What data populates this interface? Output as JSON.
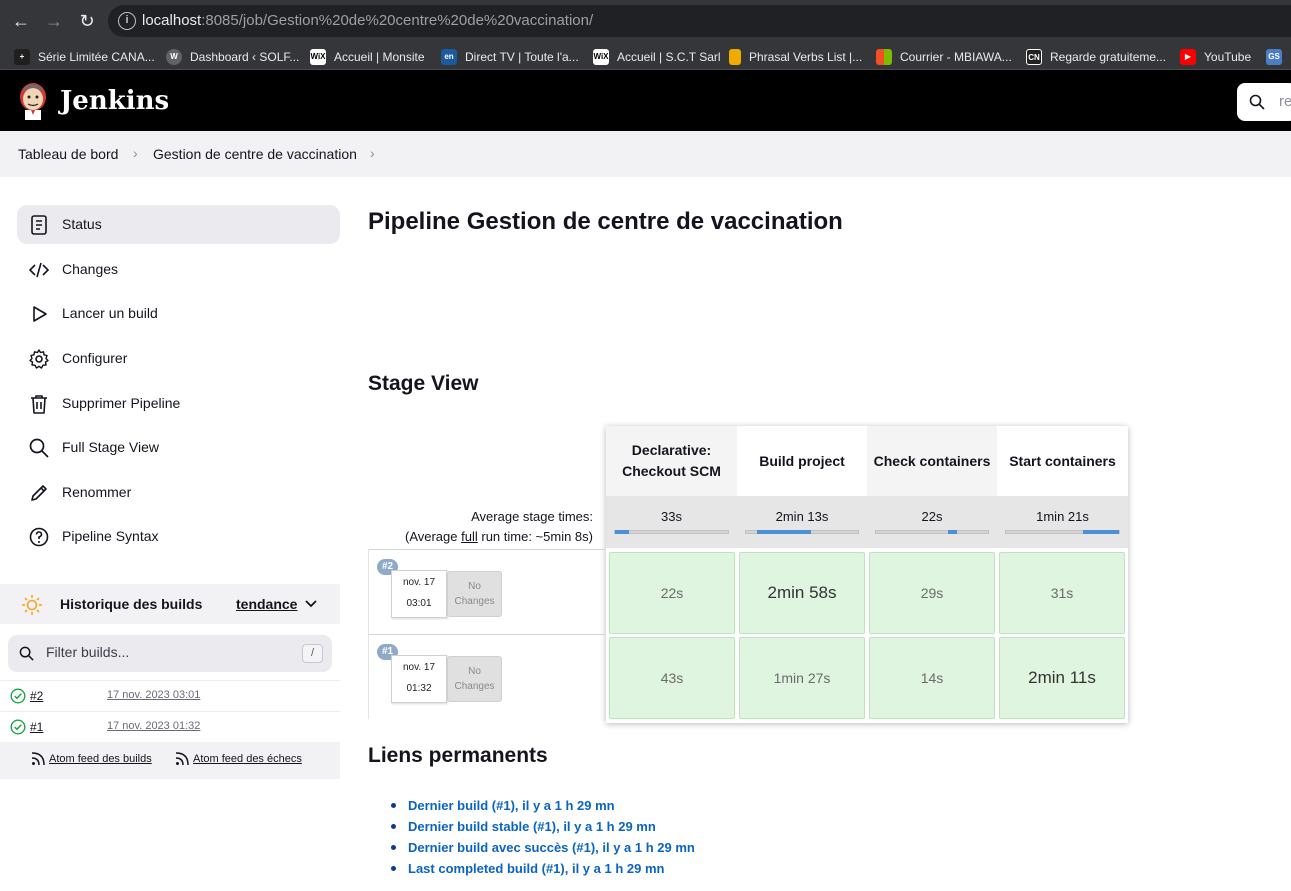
{
  "browser": {
    "url_host": "localhost",
    "url_path": ":8085/job/Gestion%20de%20centre%20de%20vaccination/",
    "bookmarks": [
      {
        "label": "Série Limitée CANA...",
        "icon": "plus-icon",
        "color": "#1f1f1f"
      },
      {
        "label": "Dashboard ‹ SOLF...",
        "icon": "wordpress-icon",
        "color": "#5f6368"
      },
      {
        "label": "Accueil | Monsite",
        "icon": "wix-icon",
        "color": "#ffffff"
      },
      {
        "label": "Direct TV | Toute l'a...",
        "icon": "en-icon",
        "color": "#1a5a9e"
      },
      {
        "label": "Accueil | S.C.T Sarl",
        "icon": "wix-icon",
        "color": "#ffffff"
      },
      {
        "label": "Phrasal Verbs List |...",
        "icon": "bookmark-icon",
        "color": "#f2a900"
      },
      {
        "label": "Courrier - MBIAWA...",
        "icon": "microsoft-icon",
        "color": "#f25022"
      },
      {
        "label": "Regarde gratuiteme...",
        "icon": "cn-icon",
        "color": "#222222"
      },
      {
        "label": "YouTube",
        "icon": "youtube-icon",
        "color": "#ff0000"
      }
    ]
  },
  "header": {
    "app_name": "Jenkins",
    "search_placeholder": "re"
  },
  "breadcrumb": {
    "items": [
      "Tableau de bord",
      "Gestion de centre de vaccination"
    ]
  },
  "sidebar": {
    "items": [
      {
        "label": "Status",
        "icon": "status-icon",
        "active": true
      },
      {
        "label": "Changes",
        "icon": "code-icon"
      },
      {
        "label": "Lancer un build",
        "icon": "play-icon"
      },
      {
        "label": "Configurer",
        "icon": "gear-icon"
      },
      {
        "label": "Supprimer Pipeline",
        "icon": "trash-icon"
      },
      {
        "label": "Full Stage View",
        "icon": "search-icon"
      },
      {
        "label": "Renommer",
        "icon": "pencil-icon"
      },
      {
        "label": "Pipeline Syntax",
        "icon": "help-icon"
      }
    ],
    "history": {
      "title": "Historique des builds",
      "trend": "tendance",
      "filter_placeholder": "Filter builds...",
      "shortcut": "/",
      "builds": [
        {
          "number": "#2",
          "date": "17 nov. 2023 03:01",
          "status": "success"
        },
        {
          "number": "#1",
          "date": "17 nov. 2023 01:32",
          "status": "success"
        }
      ],
      "feeds": [
        "Atom feed des builds",
        "Atom feed des échecs"
      ]
    }
  },
  "main": {
    "title": "Pipeline Gestion de centre de vaccination",
    "stage_view_title": "Stage View",
    "avg_label_1": "Average stage times:",
    "avg_label_2_prefix": "(Average ",
    "avg_label_2_link": "full",
    "avg_label_2_suffix": " run time: ~5min 8s)",
    "stages": [
      {
        "name": "Declarative: Checkout SCM",
        "avg": "33s"
      },
      {
        "name": "Build project",
        "avg": "2min 13s"
      },
      {
        "name": "Check containers",
        "avg": "22s"
      },
      {
        "name": "Start containers",
        "avg": "1min 21s"
      }
    ],
    "runs": [
      {
        "badge": "#2",
        "date": "nov. 17",
        "time": "03:01",
        "changes": "No Changes",
        "durations": [
          "22s",
          "2min 58s",
          "29s",
          "31s"
        ]
      },
      {
        "badge": "#1",
        "date": "nov. 17",
        "time": "01:32",
        "changes": "No Changes",
        "durations": [
          "43s",
          "1min 27s",
          "14s",
          "2min 11s"
        ]
      }
    ],
    "permalinks_title": "Liens permanents",
    "permalinks": [
      "Dernier build (#1), il y a 1 h 29 mn",
      "Dernier build stable (#1), il y a 1 h 29 mn",
      "Dernier build avec succès (#1), il y a 1 h 29 mn",
      "Last completed build (#1), il y a 1 h 29 mn"
    ]
  },
  "colors": {
    "success_cell": "#dff5df",
    "link": "#0a64c2",
    "accent_bar": "#4f8fd6"
  }
}
